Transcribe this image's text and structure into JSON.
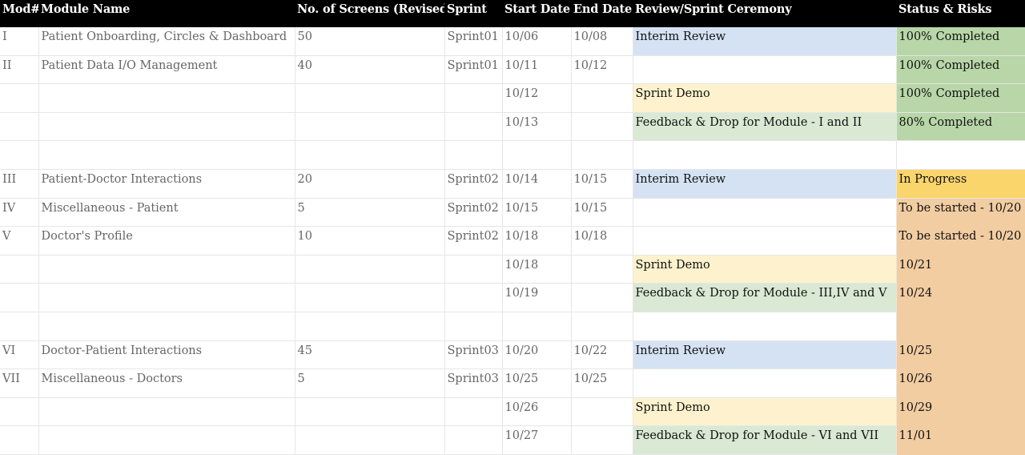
{
  "columns": [
    "Mod#",
    "Module Name",
    "No. of Screens (Revised)",
    "Sprint",
    "Start Date",
    "End Date",
    "Review/Sprint Ceremony",
    "Status & Risks"
  ],
  "colors": {
    "header_bg": "#000000",
    "interim_review": "#d5e2f3",
    "sprint_demo": "#fdf2cd",
    "feedback": "#d9e9d4",
    "completed": "#b8d6a8",
    "in_progress": "#fad56c",
    "pending": "#f2cda2"
  },
  "rows": [
    {
      "mod": "I",
      "name": "Patient Onboarding, Circles & Dashboard",
      "screens": "50",
      "sprint": "Sprint01",
      "start": "10/06",
      "end": "10/08",
      "ceremony": "Interim Review",
      "ceremony_kind": "interim",
      "status": "100% Completed",
      "status_kind": "done"
    },
    {
      "mod": "II",
      "name": "Patient Data I/O Management",
      "screens": "40",
      "sprint": "Sprint01",
      "start": "10/11",
      "end": "10/12",
      "ceremony": "",
      "ceremony_kind": "",
      "status": "100% Completed",
      "status_kind": "done"
    },
    {
      "mod": "",
      "name": "",
      "screens": "",
      "sprint": "",
      "start": "10/12",
      "end": "",
      "ceremony": "Sprint Demo",
      "ceremony_kind": "demo",
      "status": "100% Completed",
      "status_kind": "done"
    },
    {
      "mod": "",
      "name": "",
      "screens": "",
      "sprint": "",
      "start": "10/13",
      "end": "",
      "ceremony": "Feedback & Drop for Module - I and II",
      "ceremony_kind": "feedback",
      "status": "80% Completed",
      "status_kind": "done"
    },
    {
      "mod": "",
      "name": "",
      "screens": "",
      "sprint": "",
      "start": "",
      "end": "",
      "ceremony": "",
      "ceremony_kind": "",
      "status": "",
      "status_kind": ""
    },
    {
      "mod": "III",
      "name": "Patient-Doctor Interactions",
      "screens": "20",
      "sprint": "Sprint02",
      "start": "10/14",
      "end": "10/15",
      "ceremony": "Interim Review",
      "ceremony_kind": "interim",
      "status": "In Progress",
      "status_kind": "progress"
    },
    {
      "mod": "IV",
      "name": "Miscellaneous - Patient",
      "screens": "5",
      "sprint": "Sprint02",
      "start": "10/15",
      "end": "10/15",
      "ceremony": "",
      "ceremony_kind": "",
      "status": "To be started - 10/20",
      "status_kind": "pending"
    },
    {
      "mod": "V",
      "name": "Doctor's Profile",
      "screens": "10",
      "sprint": "Sprint02",
      "start": "10/18",
      "end": "10/18",
      "ceremony": "",
      "ceremony_kind": "",
      "status": "To be started - 10/20",
      "status_kind": "pending"
    },
    {
      "mod": "",
      "name": "",
      "screens": "",
      "sprint": "",
      "start": "10/18",
      "end": "",
      "ceremony": "Sprint Demo",
      "ceremony_kind": "demo",
      "status": "10/21",
      "status_kind": "pending"
    },
    {
      "mod": "",
      "name": "",
      "screens": "",
      "sprint": "",
      "start": "10/19",
      "end": "",
      "ceremony": "Feedback & Drop for Module - III,IV and V",
      "ceremony_kind": "feedback",
      "status": "10/24",
      "status_kind": "pending"
    },
    {
      "mod": "",
      "name": "",
      "screens": "",
      "sprint": "",
      "start": "",
      "end": "",
      "ceremony": "",
      "ceremony_kind": "",
      "status": "",
      "status_kind": "pending"
    },
    {
      "mod": "VI",
      "name": "Doctor-Patient Interactions",
      "screens": "45",
      "sprint": "Sprint03",
      "start": "10/20",
      "end": "10/22",
      "ceremony": "Interim Review",
      "ceremony_kind": "interim",
      "status": "10/25",
      "status_kind": "pending"
    },
    {
      "mod": "VII",
      "name": "Miscellaneous - Doctors",
      "screens": "5",
      "sprint": "Sprint03",
      "start": "10/25",
      "end": "10/25",
      "ceremony": "",
      "ceremony_kind": "",
      "status": "10/26",
      "status_kind": "pending"
    },
    {
      "mod": "",
      "name": "",
      "screens": "",
      "sprint": "",
      "start": "10/26",
      "end": "",
      "ceremony": "Sprint Demo",
      "ceremony_kind": "demo",
      "status": "10/29",
      "status_kind": "pending"
    },
    {
      "mod": "",
      "name": "",
      "screens": "",
      "sprint": "",
      "start": "10/27",
      "end": "",
      "ceremony": "Feedback & Drop for Module - VI and VII",
      "ceremony_kind": "feedback",
      "status": "11/01",
      "status_kind": "pending"
    }
  ]
}
